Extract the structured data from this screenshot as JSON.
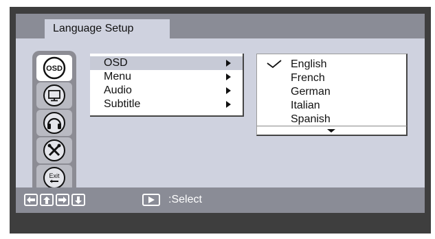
{
  "header": {
    "title": "Language Setup"
  },
  "sidebar": {
    "items": [
      {
        "name": "osd",
        "label": "OSD",
        "active": true
      },
      {
        "name": "monitor",
        "label": "",
        "active": false
      },
      {
        "name": "headphones",
        "label": "",
        "active": false
      },
      {
        "name": "tools",
        "label": "",
        "active": false
      },
      {
        "name": "exit",
        "label": "Exit",
        "active": false
      }
    ]
  },
  "menu": {
    "items": [
      {
        "label": "OSD",
        "selected": true
      },
      {
        "label": "Menu",
        "selected": false
      },
      {
        "label": "Audio",
        "selected": false
      },
      {
        "label": "Subtitle",
        "selected": false
      }
    ]
  },
  "languages": {
    "items": [
      {
        "label": "English",
        "checked": true
      },
      {
        "label": "French",
        "checked": false
      },
      {
        "label": "German",
        "checked": false
      },
      {
        "label": "Italian",
        "checked": false
      },
      {
        "label": "Spanish",
        "checked": false
      }
    ]
  },
  "footer": {
    "nav_keys": [
      "arrow-left-icon",
      "arrow-up-icon",
      "arrow-right-icon",
      "arrow-down-icon"
    ],
    "select_label": ":Select"
  },
  "colors": {
    "frame": "#3e3e3e",
    "screen": "#cfd2df",
    "bar": "#8a8c96",
    "highlight": "#c7cad6"
  }
}
